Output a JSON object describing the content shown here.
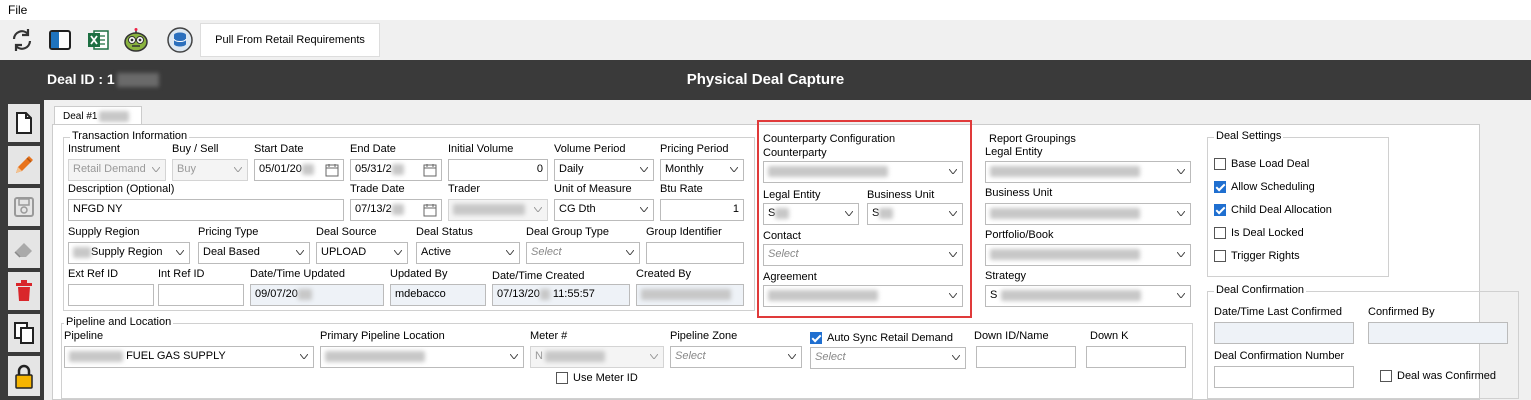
{
  "menu": {
    "file": "File"
  },
  "toolbar": {
    "icons": [
      "refresh-icon",
      "panel-icon",
      "excel-icon",
      "robot-icon",
      "database-icon"
    ],
    "pull_label": "Pull From Retail Requirements"
  },
  "header": {
    "deal_id_label": "Deal ID : 1",
    "title": "Physical Deal Capture"
  },
  "sidebar": {
    "icons": [
      "new-document-icon",
      "edit-pencil-icon",
      "save-disk-icon",
      "eraser-icon",
      "delete-trash-icon",
      "copy-icon",
      "lock-icon"
    ]
  },
  "tab": {
    "label": "Deal #1"
  },
  "transaction": {
    "title": "Transaction Information",
    "instrument": {
      "label": "Instrument",
      "value": "Retail Demand"
    },
    "buy_sell": {
      "label": "Buy / Sell",
      "value": "Buy"
    },
    "start_date": {
      "label": "Start Date",
      "value": "05/01/20"
    },
    "end_date": {
      "label": "End Date",
      "value": "05/31/2"
    },
    "initial_volume": {
      "label": "Initial Volume",
      "value": "0"
    },
    "volume_period": {
      "label": "Volume Period",
      "value": "Daily"
    },
    "pricing_period": {
      "label": "Pricing Period",
      "value": "Monthly"
    },
    "description": {
      "label": "Description (Optional)",
      "value": "NFGD NY"
    },
    "trade_date": {
      "label": "Trade Date",
      "value": "07/13/2"
    },
    "trader": {
      "label": "Trader",
      "value": ""
    },
    "unit_of_measure": {
      "label": "Unit of Measure",
      "value": "CG Dth"
    },
    "btu_rate": {
      "label": "Btu Rate",
      "value": "1"
    },
    "supply_region": {
      "label": "Supply Region",
      "value": "Supply Region"
    },
    "pricing_type": {
      "label": "Pricing Type",
      "value": "Deal Based"
    },
    "deal_source": {
      "label": "Deal Source",
      "value": "UPLOAD"
    },
    "deal_status": {
      "label": "Deal Status",
      "value": "Active"
    },
    "deal_group_type": {
      "label": "Deal Group Type",
      "placeholder": "Select"
    },
    "group_identifier": {
      "label": "Group Identifier",
      "value": ""
    },
    "ext_ref_id": {
      "label": "Ext Ref ID",
      "value": ""
    },
    "int_ref_id": {
      "label": "Int Ref ID",
      "value": ""
    },
    "datetime_updated": {
      "label": "Date/Time Updated",
      "value": "09/07/20"
    },
    "updated_by": {
      "label": "Updated By",
      "value": "mdebacco"
    },
    "datetime_created": {
      "label": "Date/Time Created",
      "value_date": "07/13/20",
      "value_time": "11:55:57"
    },
    "created_by": {
      "label": "Created By",
      "value": ""
    }
  },
  "counterparty": {
    "title": "Counterparty Configuration",
    "counterparty": {
      "label": "Counterparty",
      "value": ""
    },
    "legal_entity": {
      "label": "Legal Entity",
      "value": "S"
    },
    "business_unit": {
      "label": "Business Unit",
      "value": "S"
    },
    "contact": {
      "label": "Contact",
      "placeholder": "Select"
    },
    "agreement": {
      "label": "Agreement",
      "value": ""
    }
  },
  "report_groupings": {
    "title": "Report Groupings",
    "legal_entity": {
      "label": "Legal Entity"
    },
    "business_unit": {
      "label": "Business Unit"
    },
    "portfolio_book": {
      "label": "Portfolio/Book"
    },
    "strategy": {
      "label": "Strategy",
      "value": "S"
    }
  },
  "deal_settings": {
    "title": "Deal Settings",
    "items": [
      {
        "label": "Base Load Deal",
        "checked": false
      },
      {
        "label": "Allow Scheduling",
        "checked": true
      },
      {
        "label": "Child Deal Allocation",
        "checked": true
      },
      {
        "label": "Is Deal Locked",
        "checked": false
      },
      {
        "label": "Trigger Rights",
        "checked": false
      }
    ]
  },
  "deal_confirmation": {
    "title": "Deal Confirmation",
    "last_confirmed": {
      "label": "Date/Time Last Confirmed"
    },
    "confirmed_by": {
      "label": "Confirmed By"
    },
    "confirmation_number": {
      "label": "Deal Confirmation Number"
    },
    "was_confirmed": {
      "label": "Deal was Confirmed"
    }
  },
  "pipeline": {
    "title": "Pipeline and Location",
    "pipeline": {
      "label": "Pipeline",
      "value": "FUEL GAS SUPPLY"
    },
    "primary_location": {
      "label": "Primary Pipeline Location",
      "value": ""
    },
    "meter": {
      "label": "Meter #",
      "value": "N"
    },
    "use_meter_id": {
      "label": "Use Meter ID"
    },
    "pipeline_zone": {
      "label": "Pipeline  Zone",
      "placeholder": "Select"
    },
    "auto_sync": {
      "label": "Auto Sync Retail Demand",
      "placeholder": "Select"
    },
    "down_id": {
      "label": "Down ID/Name"
    },
    "down_k": {
      "label": "Down K"
    }
  }
}
